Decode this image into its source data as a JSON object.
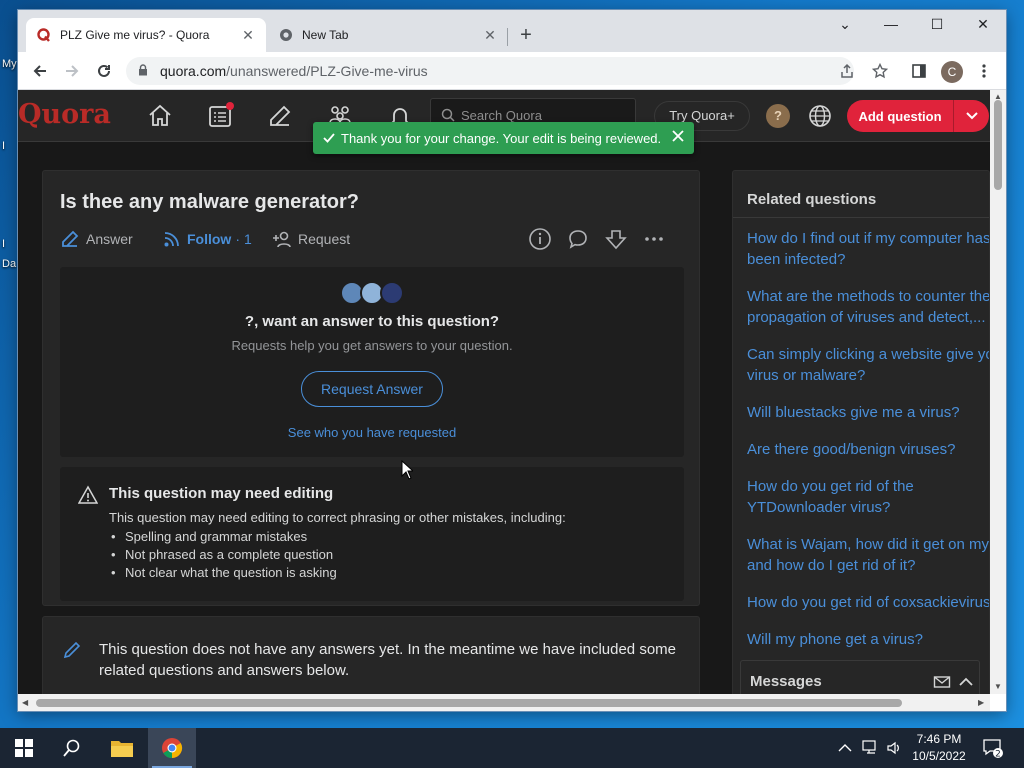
{
  "desktop": {
    "labels": [
      "My",
      "I",
      "I",
      "Da"
    ]
  },
  "browser": {
    "tabs": [
      {
        "title": "PLZ Give me virus? - Quora",
        "active": true
      },
      {
        "title": "New Tab",
        "active": false
      }
    ],
    "new_tab": "+",
    "url_host": "quora.com",
    "url_path": "/unanswered/PLZ-Give-me-virus",
    "profile_initial": "C",
    "window_controls": {
      "minimize": "—",
      "maximize": "☐",
      "close": "✕",
      "dropdown": "⌄"
    }
  },
  "quora": {
    "logo": "Quora",
    "search_placeholder": "Search Quora",
    "try_plus": "Try Quora+",
    "help": "?",
    "add_question": "Add question",
    "toast": "Thank you for your change. Your edit is being reviewed.",
    "question": {
      "title": "Is thee any malware generator?",
      "answer": "Answer",
      "follow": "Follow",
      "follow_sep": "·",
      "follow_count": "1",
      "request": "Request"
    },
    "request_box": {
      "title": "?, want an answer to this question?",
      "subtitle": "Requests help you get answers to your question.",
      "button": "Request Answer",
      "link": "See who you have requested"
    },
    "edit_box": {
      "title": "This question may need editing",
      "description": "This question may need editing to correct phrasing or other mistakes, including:",
      "items": [
        "Spelling and grammar mistakes",
        "Not phrased as a complete question",
        "Not clear what the question is asking"
      ]
    },
    "no_answers": "This question does not have any answers yet. In the meantime we have included some related questions and answers below.",
    "related": {
      "title": "Related questions",
      "items": [
        "How do I find out if my computer has been infected?",
        "What are the methods to counter the propagation of viruses and detect,...",
        "Can simply clicking a website give you virus or malware?",
        "Will bluestacks give me a virus?",
        "Are there good/benign viruses?",
        "How do you get rid of the YTDownloader virus?",
        "What is Wajam, how did it get on my and how do I get rid of it?",
        "How do you get rid of coxsackievirus",
        "Will my phone get a virus?"
      ]
    },
    "messages": "Messages"
  },
  "taskbar": {
    "time": "7:46 PM",
    "date": "10/5/2022",
    "notif_count": "2"
  },
  "colors": {
    "quora_red": "#b92b27",
    "add_button": "#e0233b",
    "link_blue": "#4a8fd9",
    "toast_green": "#2e9e52",
    "page_bg": "#181818"
  }
}
